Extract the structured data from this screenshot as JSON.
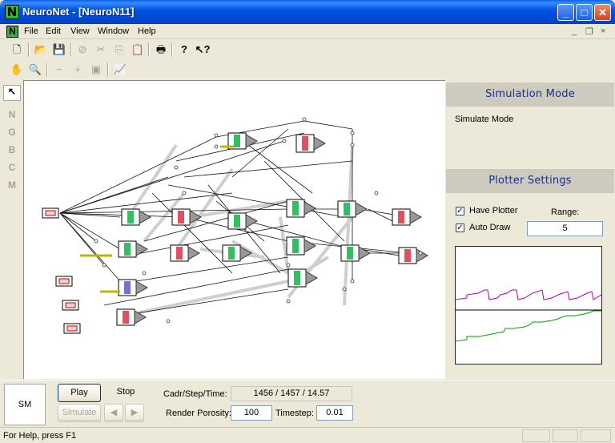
{
  "window": {
    "title": "NeuroNet - [NeuroN11]",
    "app_icon_letter": "N",
    "minimize_glyph": "_",
    "maximize_glyph": "□",
    "close_glyph": "✕"
  },
  "menu": {
    "items": [
      "File",
      "Edit",
      "View",
      "Window",
      "Help"
    ],
    "mdi_minimize": "_",
    "mdi_restore": "❐",
    "mdi_close": "×"
  },
  "vertical_tools": [
    "↖",
    "N",
    "G",
    "B",
    "C",
    "M"
  ],
  "right_panel": {
    "simulation_header": "Simulation Mode",
    "simulation_text": "Simulate Mode",
    "plotter_header": "Plotter Settings",
    "have_plotter_label": "Have Plotter",
    "have_plotter_checked": true,
    "auto_draw_label": "Auto Draw",
    "auto_draw_checked": true,
    "range_label": "Range:",
    "range_value": "5"
  },
  "controls": {
    "mode_badge": "SM",
    "play_label": "Play",
    "stop_label": "Stop",
    "simulate_label": "Simulate",
    "prev_glyph": "◀",
    "next_glyph": "▶",
    "cadr_label": "Cadr/Step/Time:",
    "cadr_value": "1456  /  1457  /  14.57",
    "render_porosity_label": "Render Porosity:",
    "render_porosity_value": "100",
    "timestep_label": "Timestep:",
    "timestep_value": "0.01"
  },
  "status": {
    "help_text": "For Help, press F1"
  },
  "colors": {
    "title_bar": "#0054e3",
    "panel_header_text": "#1c2f8a",
    "plot_series_1": "#b000b0",
    "plot_series_2": "#00a000",
    "node_red": "#e05060",
    "node_green": "#30c060"
  }
}
